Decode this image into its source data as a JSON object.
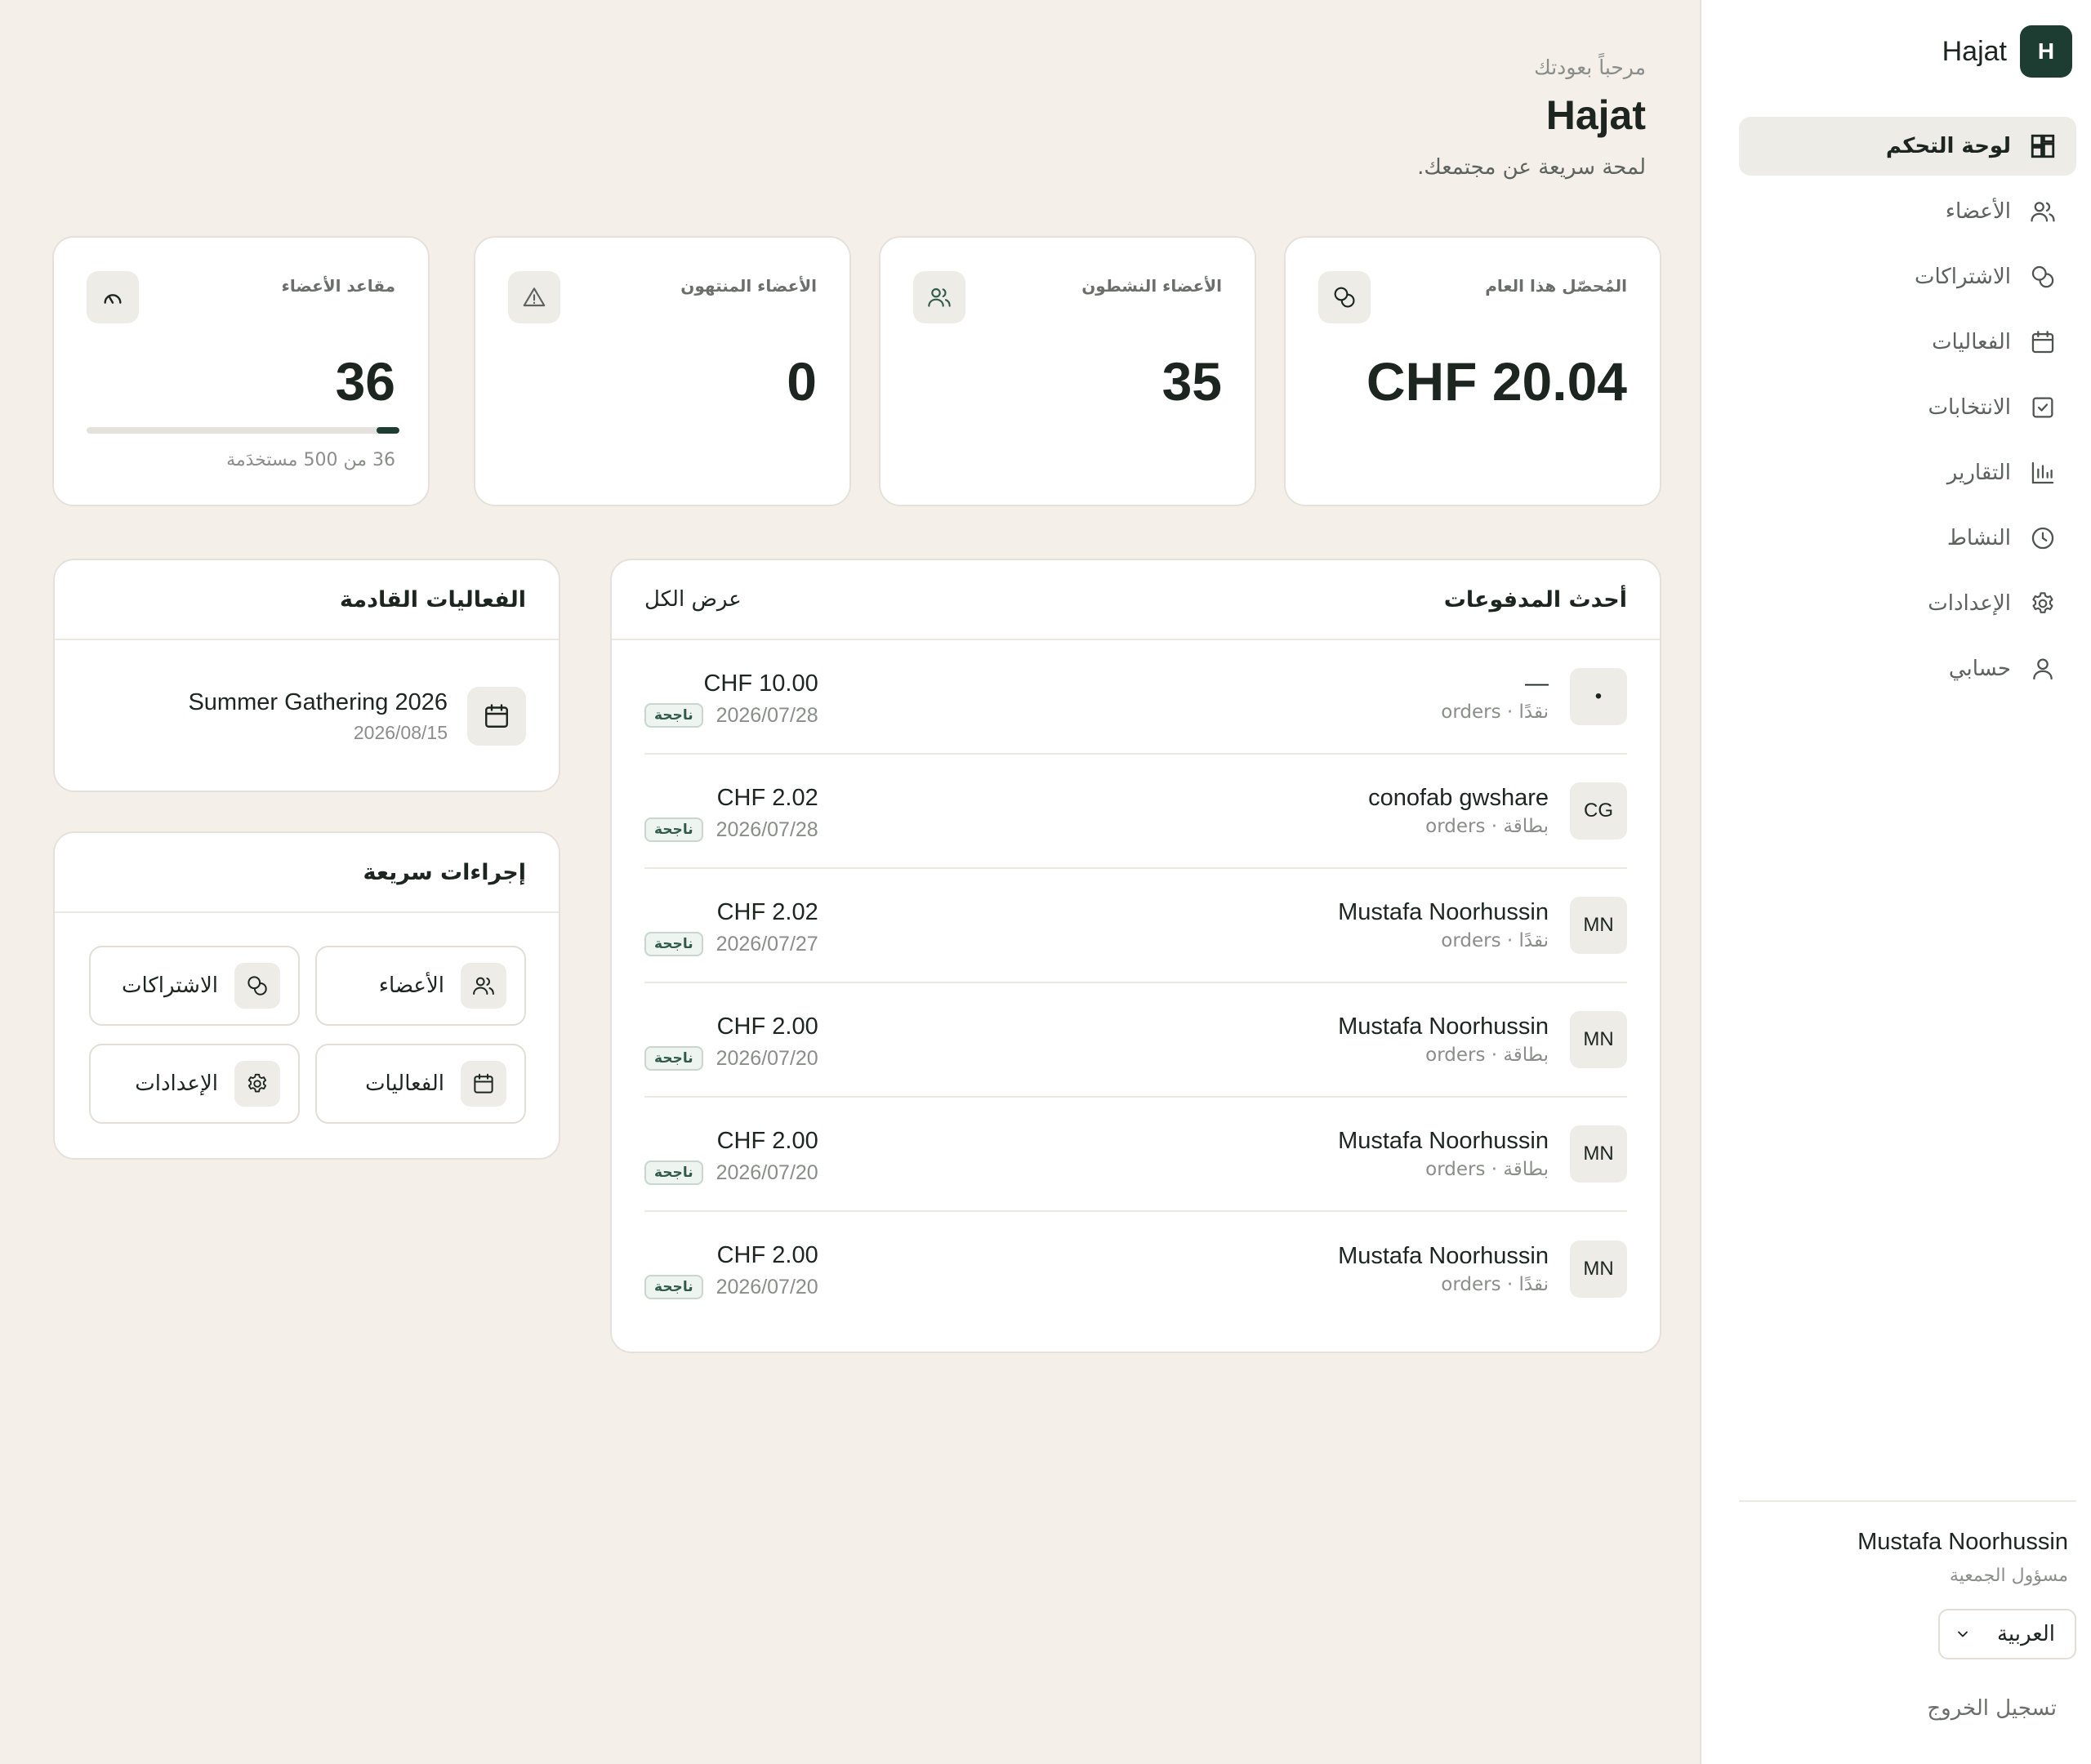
{
  "brand": {
    "name": "Hajat",
    "logo_letter": "H"
  },
  "sidebar": {
    "items": [
      {
        "label": "لوحة التحكم",
        "icon": "dashboard-icon",
        "active": true
      },
      {
        "label": "الأعضاء",
        "icon": "members-icon"
      },
      {
        "label": "الاشتراكات",
        "icon": "coins-icon"
      },
      {
        "label": "الفعاليات",
        "icon": "calendar-icon"
      },
      {
        "label": "الانتخابات",
        "icon": "vote-icon"
      },
      {
        "label": "التقارير",
        "icon": "chart-icon"
      },
      {
        "label": "النشاط",
        "icon": "clock-icon"
      },
      {
        "label": "الإعدادات",
        "icon": "gear-icon"
      },
      {
        "label": "حسابي",
        "icon": "user-icon"
      }
    ],
    "user": {
      "name": "Mustafa Noorhussin",
      "role": "مسؤول الجمعية"
    },
    "language": "العربية",
    "logout": "تسجيل الخروج"
  },
  "header": {
    "greeting": "مرحباً بعودتك",
    "title": "Hajat",
    "subtitle": "لمحة سريعة عن مجتمعك."
  },
  "stats": {
    "revenue": {
      "label": "المُحصّل هذا العام",
      "value": "CHF 20.04",
      "icon": "coins-icon"
    },
    "active": {
      "label": "الأعضاء النشطون",
      "value": "35",
      "icon": "members-icon"
    },
    "expired": {
      "label": "الأعضاء المنتهون",
      "value": "0",
      "icon": "warning-icon"
    },
    "seats": {
      "label": "مقاعد الأعضاء",
      "value": "36",
      "note": "36 من 500 مستخدَمة",
      "used_fraction": 0.072,
      "icon": "gauge-icon"
    }
  },
  "payments": {
    "title": "أحدث المدفوعات",
    "view_all": "عرض الكل",
    "rows": [
      {
        "initials": "•",
        "name": "—",
        "meta": "نقدًا · orders",
        "amount": "CHF 10.00",
        "date": "2026/07/28",
        "status": "ناجحة"
      },
      {
        "initials": "CG",
        "name": "conofab gwshare",
        "meta": "بطاقة · orders",
        "amount": "CHF 2.02",
        "date": "2026/07/28",
        "status": "ناجحة"
      },
      {
        "initials": "MN",
        "name": "Mustafa Noorhussin",
        "meta": "نقدًا · orders",
        "amount": "CHF 2.02",
        "date": "2026/07/27",
        "status": "ناجحة"
      },
      {
        "initials": "MN",
        "name": "Mustafa Noorhussin",
        "meta": "بطاقة · orders",
        "amount": "CHF 2.00",
        "date": "2026/07/20",
        "status": "ناجحة"
      },
      {
        "initials": "MN",
        "name": "Mustafa Noorhussin",
        "meta": "بطاقة · orders",
        "amount": "CHF 2.00",
        "date": "2026/07/20",
        "status": "ناجحة"
      },
      {
        "initials": "MN",
        "name": "Mustafa Noorhussin",
        "meta": "نقدًا · orders",
        "amount": "CHF 2.00",
        "date": "2026/07/20",
        "status": "ناجحة"
      }
    ]
  },
  "events": {
    "title": "الفعاليات القادمة",
    "items": [
      {
        "name": "Summer Gathering 2026",
        "date": "2026/08/15",
        "icon": "calendar-icon"
      }
    ]
  },
  "quick_actions": {
    "title": "إجراءات سريعة",
    "items": [
      {
        "label": "الأعضاء",
        "icon": "members-icon"
      },
      {
        "label": "الاشتراكات",
        "icon": "coins-icon"
      },
      {
        "label": "الفعاليات",
        "icon": "calendar-icon"
      },
      {
        "label": "الإعدادات",
        "icon": "gear-icon"
      }
    ]
  },
  "colors": {
    "background": "#f4f0e9",
    "accent": "#1d3d33",
    "success": "#2f5b4a"
  }
}
